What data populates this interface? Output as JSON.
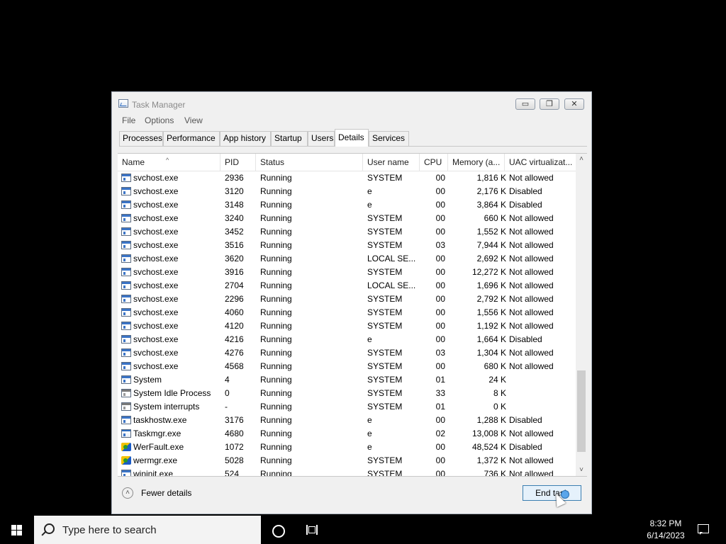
{
  "window": {
    "title": "Task Manager",
    "min_glyph": "▭",
    "max_glyph": "❐",
    "close_glyph": "✕"
  },
  "menu": [
    "File",
    "Options",
    "View"
  ],
  "tabs": [
    {
      "label": "Processes",
      "active": false
    },
    {
      "label": "Performance",
      "active": false
    },
    {
      "label": "App history",
      "active": false
    },
    {
      "label": "Startup",
      "active": false
    },
    {
      "label": "Users",
      "active": false
    },
    {
      "label": "Details",
      "active": true
    },
    {
      "label": "Services",
      "active": false
    }
  ],
  "columns": {
    "name": "Name",
    "pid": "PID",
    "status": "Status",
    "user": "User name",
    "cpu": "CPU",
    "memory": "Memory (a...",
    "uac": "UAC virtualizat...",
    "sort_indicator": "^"
  },
  "rows": [
    {
      "name": "svchost.exe",
      "icon": "svc",
      "pid": "2936",
      "status": "Running",
      "user": "SYSTEM",
      "cpu": "00",
      "mem": "1,816 K",
      "uac": "Not allowed"
    },
    {
      "name": "svchost.exe",
      "icon": "svc",
      "pid": "3120",
      "status": "Running",
      "user": "e",
      "cpu": "00",
      "mem": "2,176 K",
      "uac": "Disabled"
    },
    {
      "name": "svchost.exe",
      "icon": "svc",
      "pid": "3148",
      "status": "Running",
      "user": "e",
      "cpu": "00",
      "mem": "3,864 K",
      "uac": "Disabled"
    },
    {
      "name": "svchost.exe",
      "icon": "svc",
      "pid": "3240",
      "status": "Running",
      "user": "SYSTEM",
      "cpu": "00",
      "mem": "660 K",
      "uac": "Not allowed"
    },
    {
      "name": "svchost.exe",
      "icon": "svc",
      "pid": "3452",
      "status": "Running",
      "user": "SYSTEM",
      "cpu": "00",
      "mem": "1,552 K",
      "uac": "Not allowed"
    },
    {
      "name": "svchost.exe",
      "icon": "svc",
      "pid": "3516",
      "status": "Running",
      "user": "SYSTEM",
      "cpu": "03",
      "mem": "7,944 K",
      "uac": "Not allowed"
    },
    {
      "name": "svchost.exe",
      "icon": "svc",
      "pid": "3620",
      "status": "Running",
      "user": "LOCAL SE...",
      "cpu": "00",
      "mem": "2,692 K",
      "uac": "Not allowed"
    },
    {
      "name": "svchost.exe",
      "icon": "svc",
      "pid": "3916",
      "status": "Running",
      "user": "SYSTEM",
      "cpu": "00",
      "mem": "12,272 K",
      "uac": "Not allowed"
    },
    {
      "name": "svchost.exe",
      "icon": "svc",
      "pid": "2704",
      "status": "Running",
      "user": "LOCAL SE...",
      "cpu": "00",
      "mem": "1,696 K",
      "uac": "Not allowed"
    },
    {
      "name": "svchost.exe",
      "icon": "svc",
      "pid": "2296",
      "status": "Running",
      "user": "SYSTEM",
      "cpu": "00",
      "mem": "2,792 K",
      "uac": "Not allowed"
    },
    {
      "name": "svchost.exe",
      "icon": "svc",
      "pid": "4060",
      "status": "Running",
      "user": "SYSTEM",
      "cpu": "00",
      "mem": "1,556 K",
      "uac": "Not allowed"
    },
    {
      "name": "svchost.exe",
      "icon": "svc",
      "pid": "4120",
      "status": "Running",
      "user": "SYSTEM",
      "cpu": "00",
      "mem": "1,192 K",
      "uac": "Not allowed"
    },
    {
      "name": "svchost.exe",
      "icon": "svc",
      "pid": "4216",
      "status": "Running",
      "user": "e",
      "cpu": "00",
      "mem": "1,664 K",
      "uac": "Disabled"
    },
    {
      "name": "svchost.exe",
      "icon": "svc",
      "pid": "4276",
      "status": "Running",
      "user": "SYSTEM",
      "cpu": "03",
      "mem": "1,304 K",
      "uac": "Not allowed"
    },
    {
      "name": "svchost.exe",
      "icon": "svc",
      "pid": "4568",
      "status": "Running",
      "user": "SYSTEM",
      "cpu": "00",
      "mem": "680 K",
      "uac": "Not allowed"
    },
    {
      "name": "System",
      "icon": "svc",
      "pid": "4",
      "status": "Running",
      "user": "SYSTEM",
      "cpu": "01",
      "mem": "24 K",
      "uac": ""
    },
    {
      "name": "System Idle Process",
      "icon": "sys",
      "pid": "0",
      "status": "Running",
      "user": "SYSTEM",
      "cpu": "33",
      "mem": "8 K",
      "uac": ""
    },
    {
      "name": "System interrupts",
      "icon": "sys",
      "pid": "-",
      "status": "Running",
      "user": "SYSTEM",
      "cpu": "01",
      "mem": "0 K",
      "uac": ""
    },
    {
      "name": "taskhostw.exe",
      "icon": "svc",
      "pid": "3176",
      "status": "Running",
      "user": "e",
      "cpu": "00",
      "mem": "1,288 K",
      "uac": "Disabled"
    },
    {
      "name": "Taskmgr.exe",
      "icon": "task",
      "pid": "4680",
      "status": "Running",
      "user": "e",
      "cpu": "02",
      "mem": "13,008 K",
      "uac": "Not allowed"
    },
    {
      "name": "WerFault.exe",
      "icon": "shield",
      "pid": "1072",
      "status": "Running",
      "user": "e",
      "cpu": "00",
      "mem": "48,524 K",
      "uac": "Disabled"
    },
    {
      "name": "wermgr.exe",
      "icon": "shield",
      "pid": "5028",
      "status": "Running",
      "user": "SYSTEM",
      "cpu": "00",
      "mem": "1,372 K",
      "uac": "Not allowed"
    },
    {
      "name": "wininit.exe",
      "icon": "svc",
      "pid": "524",
      "status": "Running",
      "user": "SYSTEM",
      "cpu": "00",
      "mem": "736 K",
      "uac": "Not allowed"
    }
  ],
  "scrollbar": {
    "up_glyph": "˄",
    "down_glyph": "˅"
  },
  "footer": {
    "fewer_details": "Fewer details",
    "fewer_glyph": "˄",
    "end_task": "End task"
  },
  "taskbar": {
    "search_placeholder": "Type here to search",
    "time": "8:32 PM",
    "date": "6/14/2023"
  }
}
